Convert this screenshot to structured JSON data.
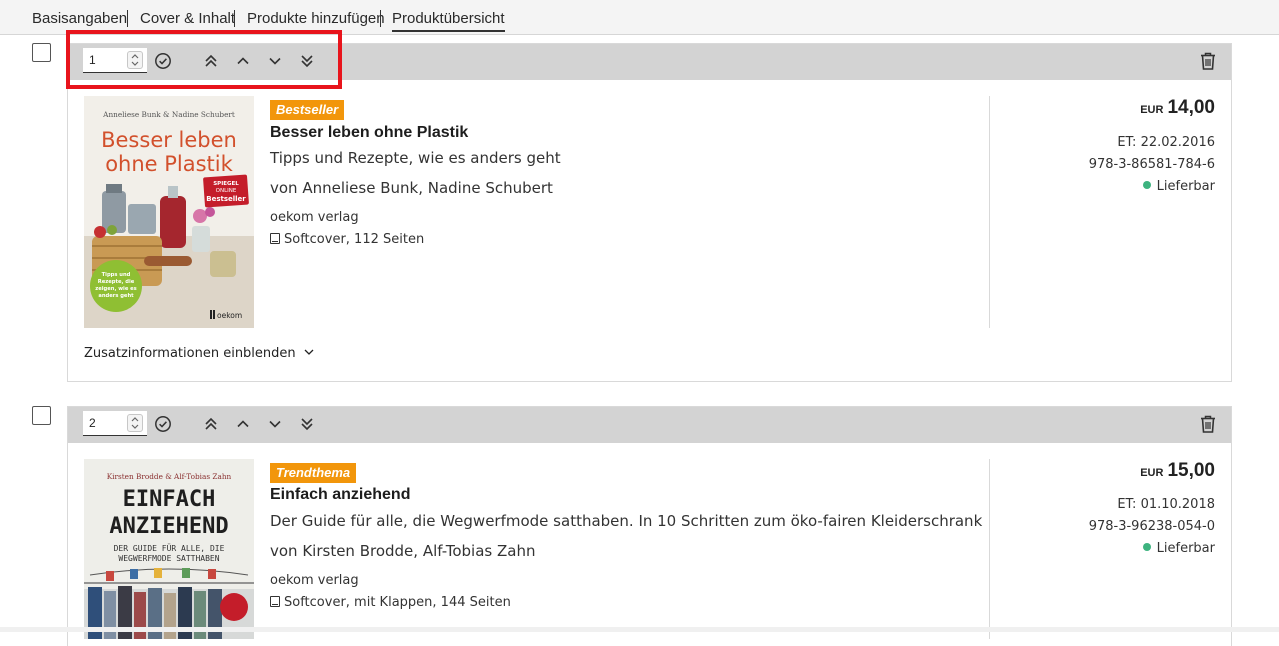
{
  "tabs": [
    {
      "label": "Basisangaben"
    },
    {
      "label": "Cover & Inhalt"
    },
    {
      "label": "Produkte hinzufügen"
    },
    {
      "label": "Produktübersicht",
      "active": true
    }
  ],
  "products": [
    {
      "position": "1",
      "badge": "Bestseller",
      "title": "Besser leben ohne Plastik",
      "subtitle": "Tipps und Rezepte, wie es anders geht",
      "authors": "von Anneliese Bunk, Nadine Schubert",
      "publisher": "oekom verlag",
      "format": "Softcover, 112 Seiten",
      "currency": "EUR",
      "price": "14,00",
      "release": "ET: 22.02.2016",
      "isbn": "978-3-86581-784-6",
      "availability": "Lieferbar",
      "more_link": "Zusatzinformationen einblenden",
      "cover": {
        "authors": "Anneliese Bunk & Nadine Schubert",
        "title_line1": "Besser leben",
        "title_line2": "ohne Plastik",
        "sticker_lines": [
          "SPIEGEL",
          "ONLINE",
          "Bestseller"
        ],
        "circle_lines": [
          "Tipps und",
          "Rezepte, die",
          "zeigen, wie es",
          "anders geht"
        ],
        "logo": "oekom"
      }
    },
    {
      "position": "2",
      "badge": "Trendthema",
      "title": "Einfach anziehend",
      "subtitle": "Der Guide für alle, die Wegwerfmode satthaben. In 10 Schritten zum öko-fairen Kleiderschrank",
      "authors": "von Kirsten Brodde, Alf-Tobias Zahn",
      "publisher": "oekom verlag",
      "format": "Softcover, mit Klappen, 144 Seiten",
      "currency": "EUR",
      "price": "15,00",
      "release": "ET: 01.10.2018",
      "isbn": "978-3-96238-054-0",
      "availability": "Lieferbar",
      "cover": {
        "authors": "Kirsten Brodde & Alf-Tobias Zahn",
        "title_line1": "EINFACH",
        "title_line2": "ANZIEHEND",
        "sub_line1": "DER GUIDE FÜR ALLE, DIE",
        "sub_line2": "WEGWERFMODE SATTHABEN"
      }
    }
  ],
  "colors": {
    "badge": "#f2960b",
    "highlight": "#e8141c",
    "available": "#3db37f",
    "header_bar": "#d3d3d3"
  },
  "icons": [
    "checkmark-circle-icon",
    "move-top-icon",
    "move-up-icon",
    "move-down-icon",
    "move-bottom-icon",
    "trash-icon",
    "chevron-down-icon",
    "book-icon"
  ]
}
